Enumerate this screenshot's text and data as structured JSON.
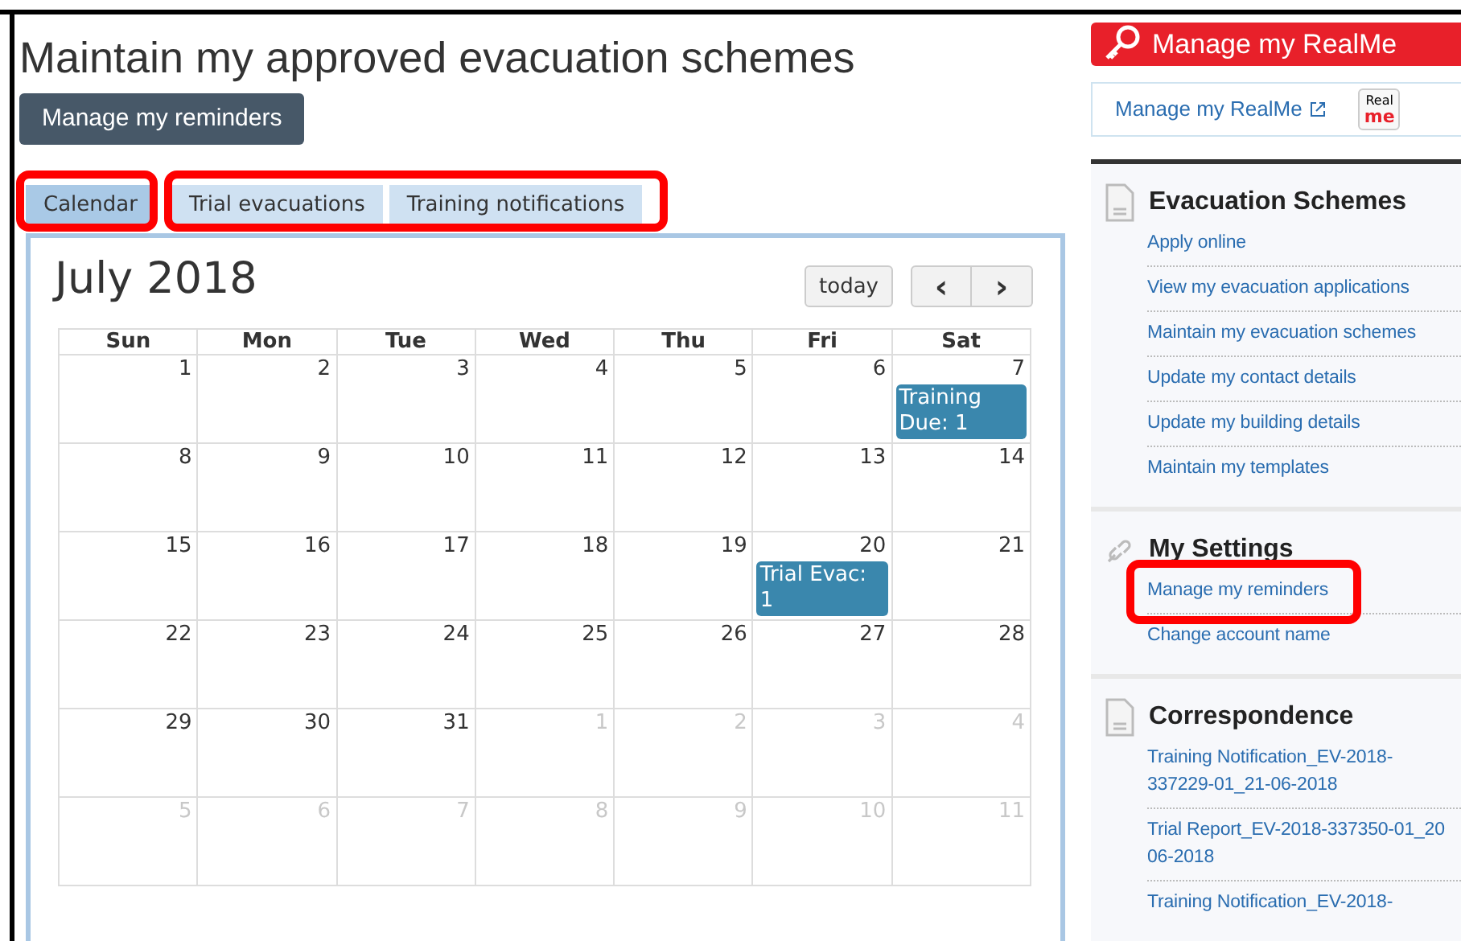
{
  "page_title": "Maintain my approved evacuation schemes",
  "reminders_button": "Manage my reminders",
  "tabs": [
    {
      "label": "Calendar",
      "selected": true
    },
    {
      "label": "Trial evacuations",
      "selected": false
    },
    {
      "label": "Training notifications",
      "selected": false
    }
  ],
  "calendar": {
    "month": "July 2018",
    "today_button": "today",
    "prev": "‹",
    "next": "›",
    "weekdays": [
      "Sun",
      "Mon",
      "Tue",
      "Wed",
      "Thu",
      "Fri",
      "Sat"
    ],
    "weeks": [
      [
        {
          "day": "1",
          "other_month": false
        },
        {
          "day": "2",
          "other_month": false
        },
        {
          "day": "3",
          "other_month": false
        },
        {
          "day": "4",
          "other_month": false
        },
        {
          "day": "5",
          "other_month": false
        },
        {
          "day": "6",
          "other_month": false
        },
        {
          "day": "7",
          "other_month": false,
          "event": "Training Due: 1"
        }
      ],
      [
        {
          "day": "8",
          "other_month": false
        },
        {
          "day": "9",
          "other_month": false
        },
        {
          "day": "10",
          "other_month": false
        },
        {
          "day": "11",
          "other_month": false
        },
        {
          "day": "12",
          "other_month": false
        },
        {
          "day": "13",
          "other_month": false
        },
        {
          "day": "14",
          "other_month": false
        }
      ],
      [
        {
          "day": "15",
          "other_month": false
        },
        {
          "day": "16",
          "other_month": false
        },
        {
          "day": "17",
          "other_month": false
        },
        {
          "day": "18",
          "other_month": false
        },
        {
          "day": "19",
          "other_month": false
        },
        {
          "day": "20",
          "other_month": false,
          "event": "Trial Evac: 1"
        },
        {
          "day": "21",
          "other_month": false
        }
      ],
      [
        {
          "day": "22",
          "other_month": false
        },
        {
          "day": "23",
          "other_month": false
        },
        {
          "day": "24",
          "other_month": false
        },
        {
          "day": "25",
          "other_month": false
        },
        {
          "day": "26",
          "other_month": false
        },
        {
          "day": "27",
          "other_month": false
        },
        {
          "day": "28",
          "other_month": false
        }
      ],
      [
        {
          "day": "29",
          "other_month": false
        },
        {
          "day": "30",
          "other_month": false
        },
        {
          "day": "31",
          "other_month": false
        },
        {
          "day": "1",
          "other_month": true
        },
        {
          "day": "2",
          "other_month": true
        },
        {
          "day": "3",
          "other_month": true
        },
        {
          "day": "4",
          "other_month": true
        }
      ],
      [
        {
          "day": "5",
          "other_month": true
        },
        {
          "day": "6",
          "other_month": true
        },
        {
          "day": "7",
          "other_month": true
        },
        {
          "day": "8",
          "other_month": true
        },
        {
          "day": "9",
          "other_month": true
        },
        {
          "day": "10",
          "other_month": true
        },
        {
          "day": "11",
          "other_month": true
        }
      ]
    ]
  },
  "sidebar": {
    "realme_banner": "Manage my RealMe",
    "realme_link": "Manage my RealMe",
    "realme_logo": [
      "Real",
      "me"
    ],
    "sections": [
      {
        "title": "Evacuation Schemes",
        "kind": "document",
        "items": [
          {
            "lines": [
              "Apply online"
            ]
          },
          {
            "lines": [
              "View my evacuation applications"
            ]
          },
          {
            "lines": [
              "Maintain my evacuation schemes"
            ]
          },
          {
            "lines": [
              "Update my contact details"
            ]
          },
          {
            "lines": [
              "Update my building details"
            ]
          },
          {
            "lines": [
              "Maintain my templates"
            ]
          }
        ]
      },
      {
        "title": "My Settings",
        "kind": "link",
        "items": [
          {
            "lines": [
              "Manage my reminders"
            ]
          },
          {
            "lines": [
              "Change account name"
            ]
          }
        ]
      },
      {
        "title": "Correspondence",
        "kind": "document",
        "items": [
          {
            "lines": [
              "Training Notification_EV-2018-",
              "337229-01_21-06-2018"
            ]
          },
          {
            "lines": [
              "Trial Report_EV-2018-337350-01_20",
              "06-2018"
            ]
          },
          {
            "lines": [
              "Training Notification_EV-2018-"
            ]
          }
        ]
      }
    ]
  }
}
